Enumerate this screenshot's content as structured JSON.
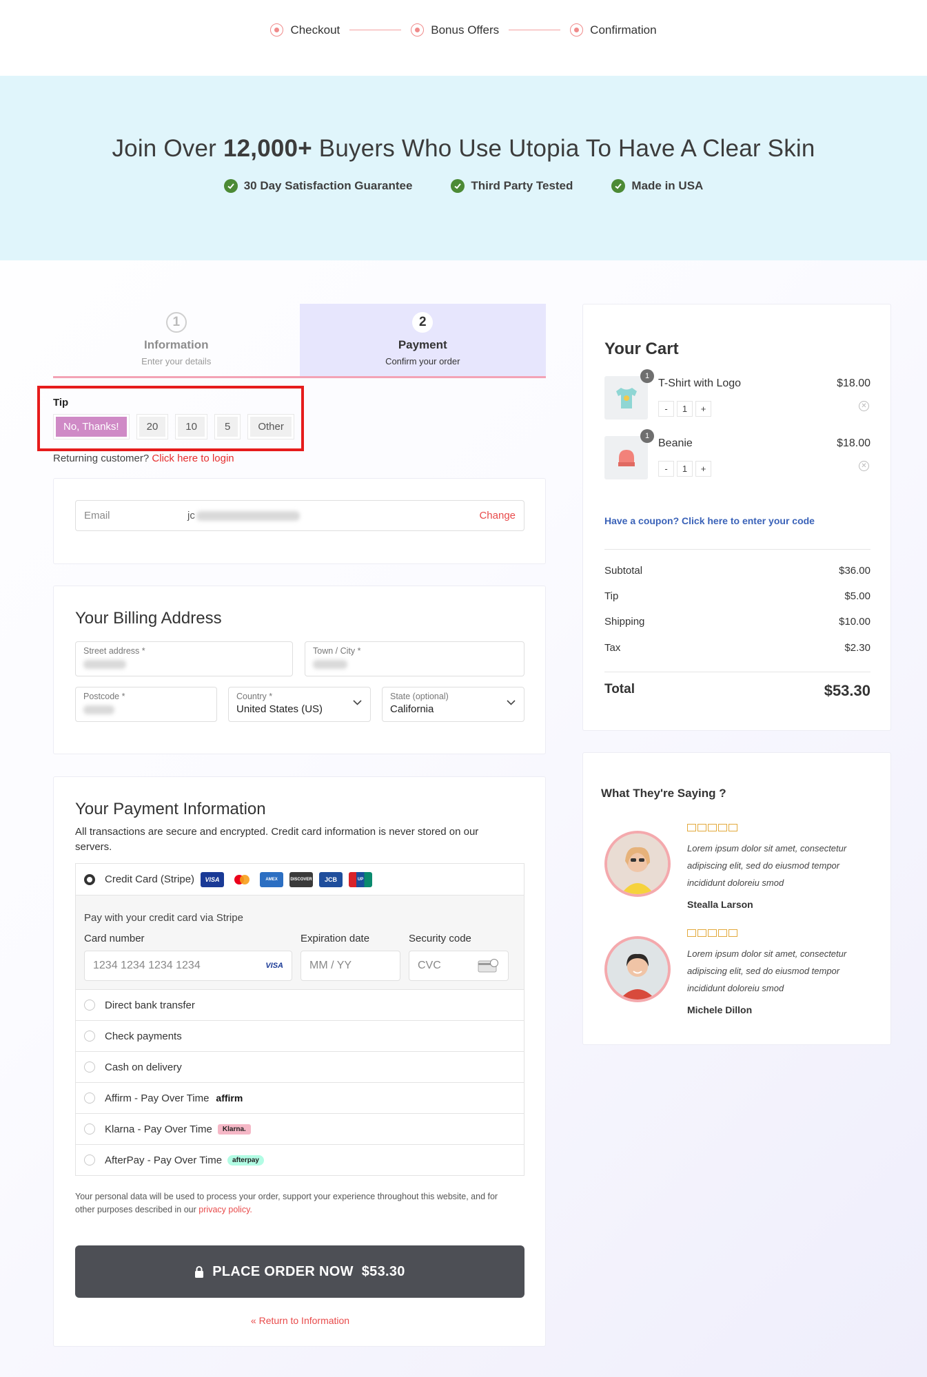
{
  "steps": [
    "Checkout",
    "Bonus Offers",
    "Confirmation"
  ],
  "hero": {
    "title_prefix": "Join Over",
    "title_bold": "12,000+",
    "title_suffix": "Buyers Who Use Utopia To Have A Clear Skin",
    "badges": [
      "30 Day Satisfaction Guarantee",
      "Third Party Tested",
      "Made in USA"
    ]
  },
  "tabs": [
    {
      "num": "1",
      "title": "Information",
      "subtitle": "Enter your details"
    },
    {
      "num": "2",
      "title": "Payment",
      "subtitle": "Confirm your order"
    }
  ],
  "tip": {
    "label": "Tip",
    "options": [
      "No, Thanks!",
      "20",
      "10",
      "5",
      "Other"
    ],
    "selected": "No, Thanks!"
  },
  "returning": {
    "text": "Returning customer?",
    "link": "Click here to login"
  },
  "email": {
    "label": "Email",
    "value_visible": "jc",
    "change": "Change"
  },
  "billing": {
    "title": "Your Billing Address",
    "street_label": "Street address *",
    "city_label": "Town / City *",
    "postcode_label": "Postcode *",
    "country_label": "Country *",
    "country_value": "United States (US)",
    "state_label": "State (optional)",
    "state_value": "California"
  },
  "payment": {
    "title": "Your Payment Information",
    "description": "All transactions are secure and encrypted. Credit card information is never stored on our servers.",
    "methods": [
      "Credit Card (Stripe)",
      "Direct bank transfer",
      "Check payments",
      "Cash on delivery",
      "Affirm - Pay Over Time",
      "Klarna - Pay Over Time",
      "AfterPay - Pay Over Time"
    ],
    "selected": "Credit Card (Stripe)",
    "stripe_text": "Pay with your credit card via Stripe",
    "card_number_label": "Card number",
    "card_number_placeholder": "1234 1234 1234 1234",
    "expiry_label": "Expiration date",
    "expiry_placeholder": "MM / YY",
    "cvc_label": "Security code",
    "cvc_placeholder": "CVC",
    "tags": {
      "affirm": "affirm",
      "klarna": "Klarna.",
      "afterpay": "afterpay"
    }
  },
  "privacy": {
    "text": "Your personal data will be used to process your order, support your experience throughout this website, and for other purposes described in our",
    "link": "privacy policy."
  },
  "place_order": {
    "label": "PLACE ORDER NOW",
    "amount": "$53.30"
  },
  "return_link": "« Return to Information",
  "cart": {
    "title": "Your Cart",
    "items": [
      {
        "name": "T-Shirt with Logo",
        "price": "$18.00",
        "qty": "1"
      },
      {
        "name": "Beanie",
        "price": "$18.00",
        "qty": "1"
      }
    ],
    "coupon": "Have a coupon? Click here to enter your code",
    "summary": [
      {
        "label": "Subtotal",
        "value": "$36.00"
      },
      {
        "label": "Tip",
        "value": "$5.00"
      },
      {
        "label": "Shipping",
        "value": "$10.00"
      },
      {
        "label": "Tax",
        "value": "$2.30"
      }
    ],
    "total_label": "Total",
    "total_value": "$53.30"
  },
  "reviews": {
    "title": "What They're Saying ?",
    "items": [
      {
        "text": "Lorem ipsum dolor sit amet, consectetur adipiscing elit, sed do eiusmod tempor incididunt doloreiu smod",
        "name": "Stealla Larson"
      },
      {
        "text": "Lorem ipsum dolor sit amet, consectetur adipiscing elit, sed do eiusmod tempor incididunt doloreiu smod",
        "name": "Michele Dillon"
      }
    ]
  },
  "colors": {
    "accent": "#f08a8a",
    "hero_bg": "#e0f5fb",
    "tip_selected": "#cf8ac6",
    "button_bg": "#4d4f55",
    "link_red": "#e52d2d",
    "coupon_blue": "#3a62b8"
  }
}
